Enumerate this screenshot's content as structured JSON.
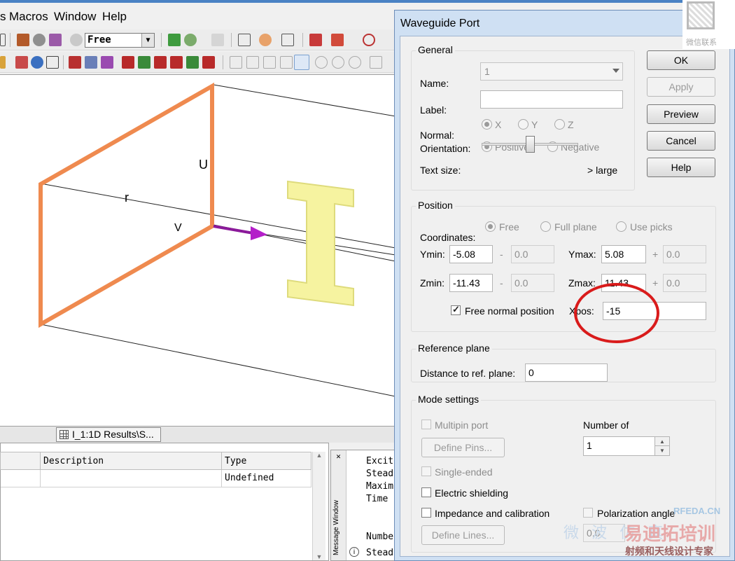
{
  "menu": {
    "partial": "s",
    "items": [
      "Macros",
      "Window",
      "Help"
    ]
  },
  "toolbar": {
    "mode_combo": "Free"
  },
  "viewport": {
    "labels": [
      "U",
      "V",
      "r"
    ]
  },
  "tabs": {
    "results_tab": "I_1:1D Results\\S..."
  },
  "table": {
    "headers": [
      "Description",
      "Type"
    ],
    "rows": [
      {
        "description": "",
        "type": "Undefined"
      }
    ]
  },
  "message_window": {
    "title": "Message Window",
    "lines": [
      "Excit",
      "Stead",
      "Maxim",
      "Time",
      "Numbe",
      "Stead"
    ]
  },
  "dialog": {
    "title": "Waveguide Port",
    "close": "✕",
    "buttons": {
      "ok": "OK",
      "apply": "Apply",
      "preview": "Preview",
      "cancel": "Cancel",
      "help": "Help"
    },
    "general": {
      "title": "General",
      "name_label": "Name:",
      "name_value": "1",
      "label_label": "Label:",
      "label_value": "",
      "normal_label": "Normal:",
      "normal_options": [
        "X",
        "Y",
        "Z"
      ],
      "normal_selected": "X",
      "orientation_label": "Orientation:",
      "orientation_options": [
        "Positive",
        "Negative"
      ],
      "orientation_selected": "Positive",
      "textsize_label": "Text size:",
      "textsize_suffix": "> large",
      "textsize_level": 0.5
    },
    "position": {
      "title": "Position",
      "coords_label": "Coordinates:",
      "coords_options": [
        "Free",
        "Full plane",
        "Use picks"
      ],
      "coords_selected": "Free",
      "ymin_label": "Ymin:",
      "ymin": "-5.08",
      "ymin_offset": "0.0",
      "ymax_label": "Ymax:",
      "ymax": "5.08",
      "ymax_offset": "0.0",
      "zmin_label": "Zmin:",
      "zmin": "-11.43",
      "zmin_offset": "0.0",
      "zmax_label": "Zmax:",
      "zmax": "11.43",
      "zmax_offset": "0.0",
      "minus": "-",
      "plus": "+",
      "free_normal_label": "Free normal position",
      "free_normal_checked": true,
      "xpos_label": "Xpos:",
      "xpos": "-15"
    },
    "reference": {
      "title": "Reference plane",
      "distance_label": "Distance to ref. plane:",
      "distance": "0"
    },
    "mode": {
      "title": "Mode settings",
      "multipin": "Multipin port",
      "define_pins": "Define Pins...",
      "number_of_label": "Number of",
      "number_of": "1",
      "single_ended": "Single-ended",
      "electric_shielding": "Electric shielding",
      "impedance": "Impedance and calibration",
      "polarization": "Polarization angle",
      "polarization_value": "0.0",
      "define_lines": "Define Lines..."
    }
  },
  "watermark": {
    "wechat": "微信联系",
    "site": "RFEDA.CN",
    "brand": "易迪拓培训",
    "slogan": "射频和天线设计专家",
    "faint": "微 波 仿 真"
  },
  "colors": {
    "port_frame": "#ef8a4f",
    "arrow": "#8b1a9a",
    "ibeam": "#f6f3a0",
    "highlight_circle": "#d91b1b",
    "dialog_frame": "#cfe0f3"
  }
}
